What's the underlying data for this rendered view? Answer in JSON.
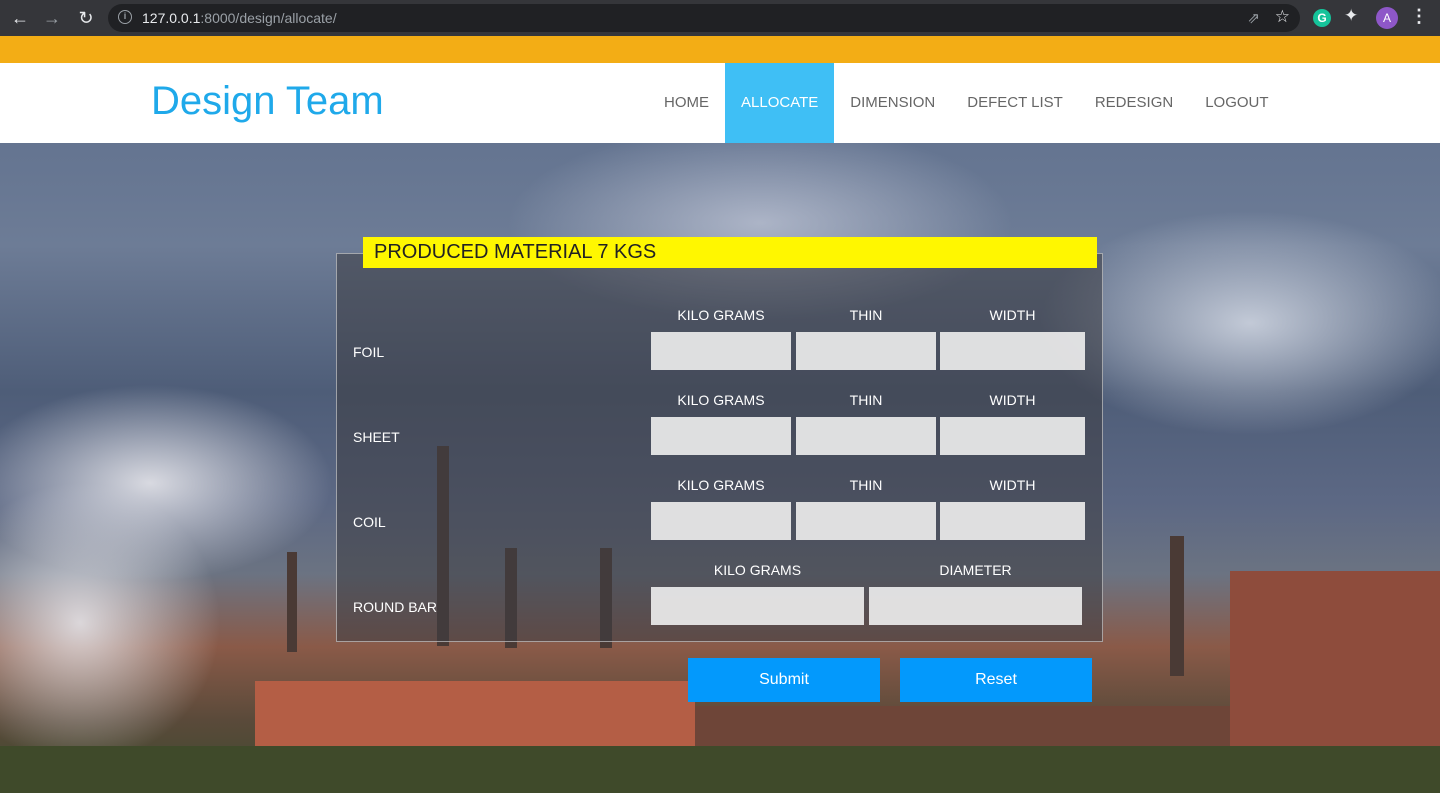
{
  "browser": {
    "url_host": "127.0.0.1",
    "url_rest": ":8000/design/allocate/",
    "profile_initial": "A",
    "extension_initial": "G"
  },
  "header": {
    "brand": "Design Team",
    "nav": [
      {
        "label": "HOME",
        "active": false
      },
      {
        "label": "ALLOCATE",
        "active": true
      },
      {
        "label": "DIMENSION",
        "active": false
      },
      {
        "label": "DEFECT LIST",
        "active": false
      },
      {
        "label": "REDESIGN",
        "active": false
      },
      {
        "label": "LOGOUT",
        "active": false
      }
    ]
  },
  "form": {
    "title": "PRODUCED MATERIAL 7 KGS",
    "rows": [
      {
        "label": "FOIL",
        "columns": [
          "KILO GRAMS",
          "THIN",
          "WIDTH"
        ]
      },
      {
        "label": "SHEET",
        "columns": [
          "KILO GRAMS",
          "THIN",
          "WIDTH"
        ]
      },
      {
        "label": "COIL",
        "columns": [
          "KILO GRAMS",
          "THIN",
          "WIDTH"
        ]
      },
      {
        "label": "ROUND BAR",
        "columns": [
          "KILO GRAMS",
          "DIAMETER"
        ]
      }
    ],
    "submit_label": "Submit",
    "reset_label": "Reset"
  },
  "colors": {
    "accent_bar": "#f3ad15",
    "brand": "#1fa9ea",
    "active_nav": "#3fbff5",
    "legend_bg": "#fff700",
    "button": "#0399fc"
  }
}
